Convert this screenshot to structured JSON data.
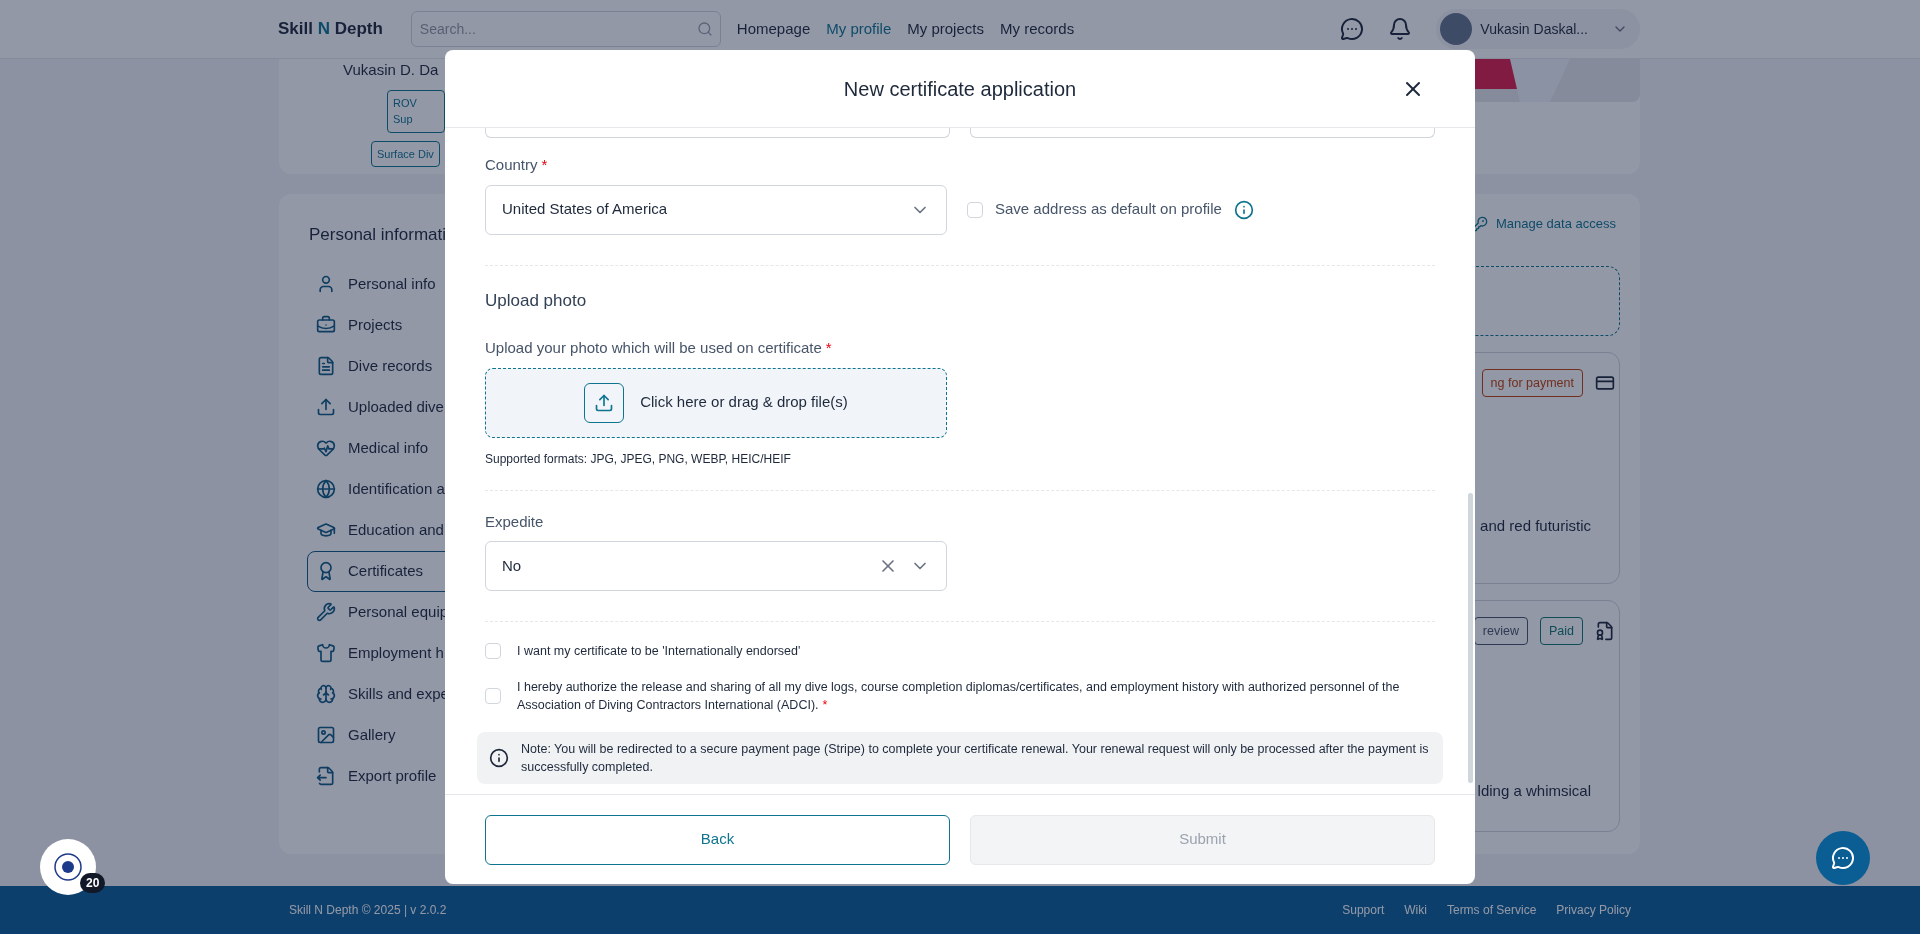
{
  "header": {
    "logo": {
      "part1": "Skill ",
      "part2": "N",
      "part3": " Depth"
    },
    "search": {
      "placeholder": "Search..."
    },
    "nav": [
      {
        "label": "Homepage",
        "selected": false
      },
      {
        "label": "My profile",
        "selected": true
      },
      {
        "label": "My projects",
        "selected": false
      },
      {
        "label": "My records",
        "selected": false
      }
    ],
    "user_name": "Vukasin Daskal..."
  },
  "profile": {
    "name": "Vukasin D. Da",
    "badges": [
      "ROV Sup",
      "Surface Div"
    ]
  },
  "sidebar": {
    "title": "Personal informati",
    "items": [
      {
        "label": "Personal info",
        "selected": false
      },
      {
        "label": "Projects",
        "selected": false
      },
      {
        "label": "Dive records",
        "selected": false
      },
      {
        "label": "Uploaded dive",
        "selected": false
      },
      {
        "label": "Medical info",
        "selected": false
      },
      {
        "label": "Identification a",
        "selected": false
      },
      {
        "label": "Education and",
        "selected": false
      },
      {
        "label": "Certificates",
        "selected": true
      },
      {
        "label": "Personal equip",
        "selected": false
      },
      {
        "label": "Employment h",
        "selected": false
      },
      {
        "label": "Skills and expe",
        "selected": false
      },
      {
        "label": "Gallery",
        "selected": false
      },
      {
        "label": "Export profile",
        "selected": false
      }
    ]
  },
  "main": {
    "manage_link": "Manage data access",
    "cards": [
      {
        "tags": [
          {
            "label": "ng for payment",
            "kind": "warning"
          }
        ],
        "text": "and red futuristic"
      },
      {
        "tags": [
          {
            "label": "review",
            "kind": "neutral"
          },
          {
            "label": "Paid",
            "kind": "success"
          }
        ],
        "text": "lding a whimsical"
      }
    ]
  },
  "modal": {
    "title": "New certificate application",
    "country": {
      "label": "Country",
      "required_mark": "*",
      "value": "United States of America"
    },
    "save_default": {
      "label": "Save address as default on profile",
      "checked": false
    },
    "upload_section": "Upload photo",
    "upload": {
      "label": "Upload your photo which will be used on certificate",
      "required_mark": "*",
      "prompt": "Click here or drag & drop file(s)",
      "hint": "Supported formats: JPG, JPEG, PNG, WEBP, HEIC/HEIF"
    },
    "expedite": {
      "label": "Expedite",
      "value": "No"
    },
    "checks": [
      {
        "label": "I want my certificate to be 'Internationally endorsed'",
        "checked": false
      },
      {
        "label": "I hereby authorize the release and sharing of all my dive logs, course completion diplomas/certificates, and employment history with authorized personnel of the Association of Diving Contractors International (ADCI).",
        "checked": false,
        "required_mark": "*"
      }
    ],
    "note": "Note: You will be redirected to a secure payment page (Stripe) to complete your certificate renewal. Your renewal request will only be processed after the payment is successfully completed.",
    "buttons": [
      {
        "label": "Back",
        "disabled": false
      },
      {
        "label": "Submit",
        "disabled": true
      }
    ]
  },
  "badge_count": "20",
  "footer": {
    "copyright": "Skill N Depth © 2025 | v 2.0.2",
    "links": [
      "Support",
      "Wiki",
      "Terms of Service",
      "Privacy Policy"
    ]
  }
}
